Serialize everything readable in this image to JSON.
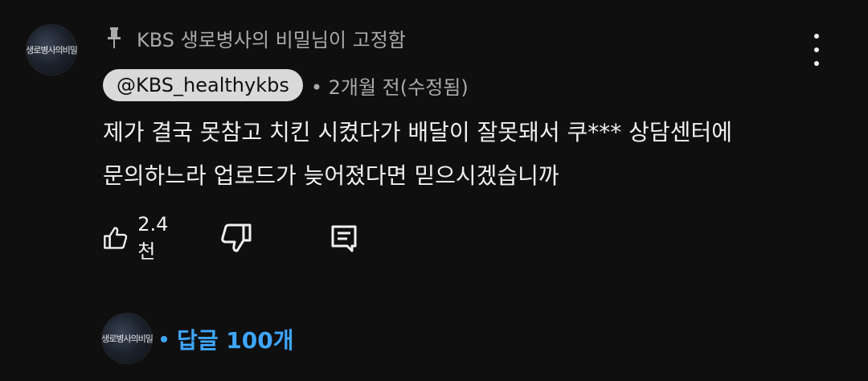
{
  "comment": {
    "avatar_text": "생로병사의비밀",
    "pinned_label": "KBS 생로병사의 비밀님이 고정함",
    "author": "@KBS_healthykbs",
    "meta": "• 2개월 전(수정됨)",
    "text_lines": [
      "제가 결국 못참고 치킨 시켰다가 배달이 잘못돼서 쿠*** 상담센터에",
      "문의하느라 업로드가 늦어졌다면 믿으시겠습니까"
    ],
    "like_count": "2.4천"
  },
  "replies": {
    "avatar_text": "생로병사의비밀",
    "label": "답글 100개"
  },
  "icons": {
    "pin": "pin-icon",
    "menu": "more-vert-icon",
    "like": "thumb-up-icon",
    "dislike": "thumb-down-icon",
    "reply": "comment-reply-icon"
  },
  "colors": {
    "background": "#0f0f0f",
    "text": "#f1f1f1",
    "secondary": "#aaaaaa",
    "chip": "#d9d9d9",
    "link": "#3ea6ff"
  }
}
